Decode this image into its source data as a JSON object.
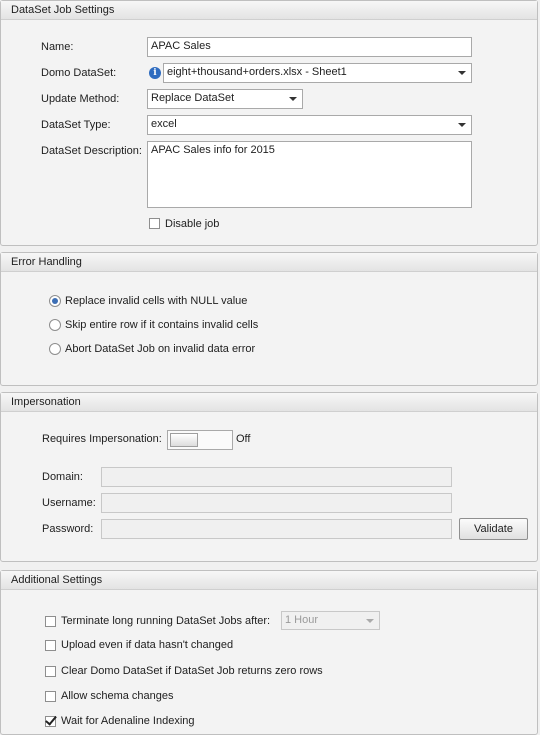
{
  "job_settings": {
    "title": "DataSet Job Settings",
    "name_label": "Name:",
    "name_value": "APAC Sales",
    "dataset_label": "Domo DataSet:",
    "dataset_value": "eight+thousand+orders.xlsx - Sheet1",
    "update_method_label": "Update Method:",
    "update_method_value": "Replace DataSet",
    "dataset_type_label": "DataSet Type:",
    "dataset_type_value": "excel",
    "description_label": "DataSet Description:",
    "description_value": "APAC Sales info for 2015",
    "disable_job_label": "Disable job",
    "disable_job_checked": false
  },
  "error_handling": {
    "title": "Error Handling",
    "options": [
      {
        "label": "Replace invalid cells with NULL value",
        "selected": true
      },
      {
        "label": "Skip entire row if it contains invalid cells",
        "selected": false
      },
      {
        "label": "Abort DataSet Job on invalid data error",
        "selected": false
      }
    ]
  },
  "impersonation": {
    "title": "Impersonation",
    "requires_label": "Requires Impersonation:",
    "toggle_state": "Off",
    "domain_label": "Domain:",
    "username_label": "Username:",
    "password_label": "Password:",
    "validate_label": "Validate"
  },
  "additional": {
    "title": "Additional Settings",
    "terminate_label": "Terminate long running DataSet Jobs after:",
    "terminate_value": "1 Hour",
    "upload_label": "Upload even if data hasn't changed",
    "clear_label": "Clear Domo DataSet if DataSet Job returns zero rows",
    "schema_label": "Allow schema changes",
    "wait_label": "Wait for Adenaline Indexing",
    "checked": {
      "terminate": false,
      "upload": false,
      "clear": false,
      "schema": false,
      "wait": true
    }
  },
  "icons": {
    "info": "info-icon",
    "dropdown": "chevron-down-icon"
  },
  "colors": {
    "radio_selected": "#3d6fb5",
    "info_icon": "#2f6cc0"
  }
}
